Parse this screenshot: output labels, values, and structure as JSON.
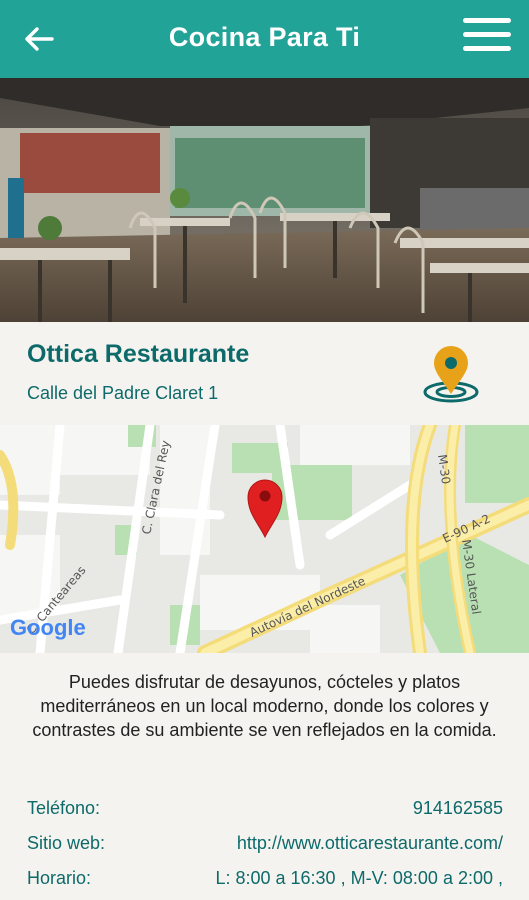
{
  "app": {
    "title": "Cocina Para Ti"
  },
  "icons": {
    "back": "arrow-left-icon",
    "menu": "hamburger-menu-icon",
    "location": "location-pin-icon",
    "map_marker": "map-marker-icon"
  },
  "colors": {
    "appbar": "#22a398",
    "accent_text": "#0d6a6a",
    "pin": "#e8a21a",
    "marker": "#e02020"
  },
  "restaurant": {
    "name": "Ottica Restaurante",
    "address": "Calle del Padre Claret 1",
    "description": "Puedes disfrutar de desayunos, cócteles y platos mediterráneos en un local moderno, donde los colores y contrastes de su ambiente se ven reflejados en la comida."
  },
  "map": {
    "labels": [
      "C. Clara del Rey",
      "Autovía del Nordeste",
      "M-30 Lateral",
      "M-30",
      "E-90 A-2",
      "C. Canteareas"
    ],
    "attribution": "Google"
  },
  "details": [
    {
      "label": "Teléfono:",
      "value": "914162585"
    },
    {
      "label": "Sitio web:",
      "value": "http://www.otticarestaurante.com/"
    },
    {
      "label": "Horario:",
      "value": "L: 8:00 a 16:30 , M-V: 08:00 a 2:00 ,"
    }
  ]
}
